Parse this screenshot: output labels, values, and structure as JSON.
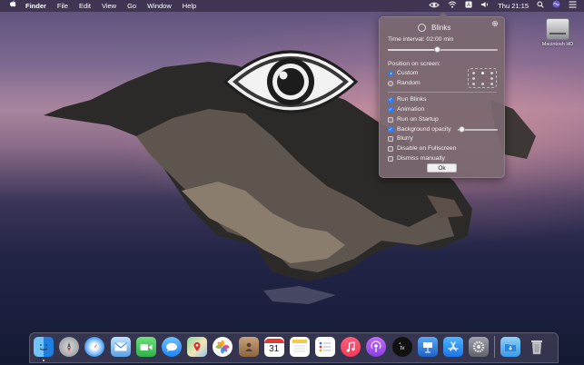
{
  "menubar": {
    "apple_icon": "apple-logo-icon",
    "items": [
      "Finder",
      "File",
      "Edit",
      "View",
      "Go",
      "Window",
      "Help"
    ],
    "clock": "Thu 21:15",
    "status_icons": [
      "blinks-eye-icon",
      "wifi-icon",
      "keyboard-input-icon",
      "volume-icon",
      "clock-text",
      "search-icon",
      "siri-icon",
      "notification-center-icon"
    ]
  },
  "desktop": {
    "drive_label": "Macintosh HD"
  },
  "popover": {
    "title": "Blinks",
    "time_interval_label": "Time interval: 02:00 min",
    "time_interval_value": 0.45,
    "position_label": "Position on screen:",
    "position_options": {
      "custom": "Custom",
      "random": "Random"
    },
    "position_selected": "Custom",
    "options": {
      "run_blinks": "Run Blinks",
      "animation": "Animation",
      "run_on_startup": "Run on Startup",
      "background_opacity": "Background opacity",
      "blurry": "Blurry",
      "disable_fullscreen": "Disable on Fullscreen",
      "dismiss_manually": "Dismiss manually"
    },
    "checked": {
      "run_blinks": true,
      "animation": true,
      "run_on_startup": false,
      "background_opacity": true,
      "blurry": false,
      "disable_fullscreen": false,
      "dismiss_manually": false
    },
    "background_opacity_value": 0.1,
    "ok_label": "Ok"
  },
  "dock": {
    "apps": [
      "Finder",
      "Launchpad",
      "Safari",
      "Mail",
      "FaceTime",
      "Messages",
      "Maps",
      "Photos",
      "Contacts",
      "Calendar",
      "Notes",
      "Reminders",
      "Music",
      "Podcasts",
      "TV",
      "Keynote",
      "App Store",
      "System Preferences",
      "Downloads",
      "Trash"
    ],
    "calendar_date": "31"
  },
  "colors": {
    "accent": "#2f7df7",
    "popover_bg": "#7a6870"
  }
}
